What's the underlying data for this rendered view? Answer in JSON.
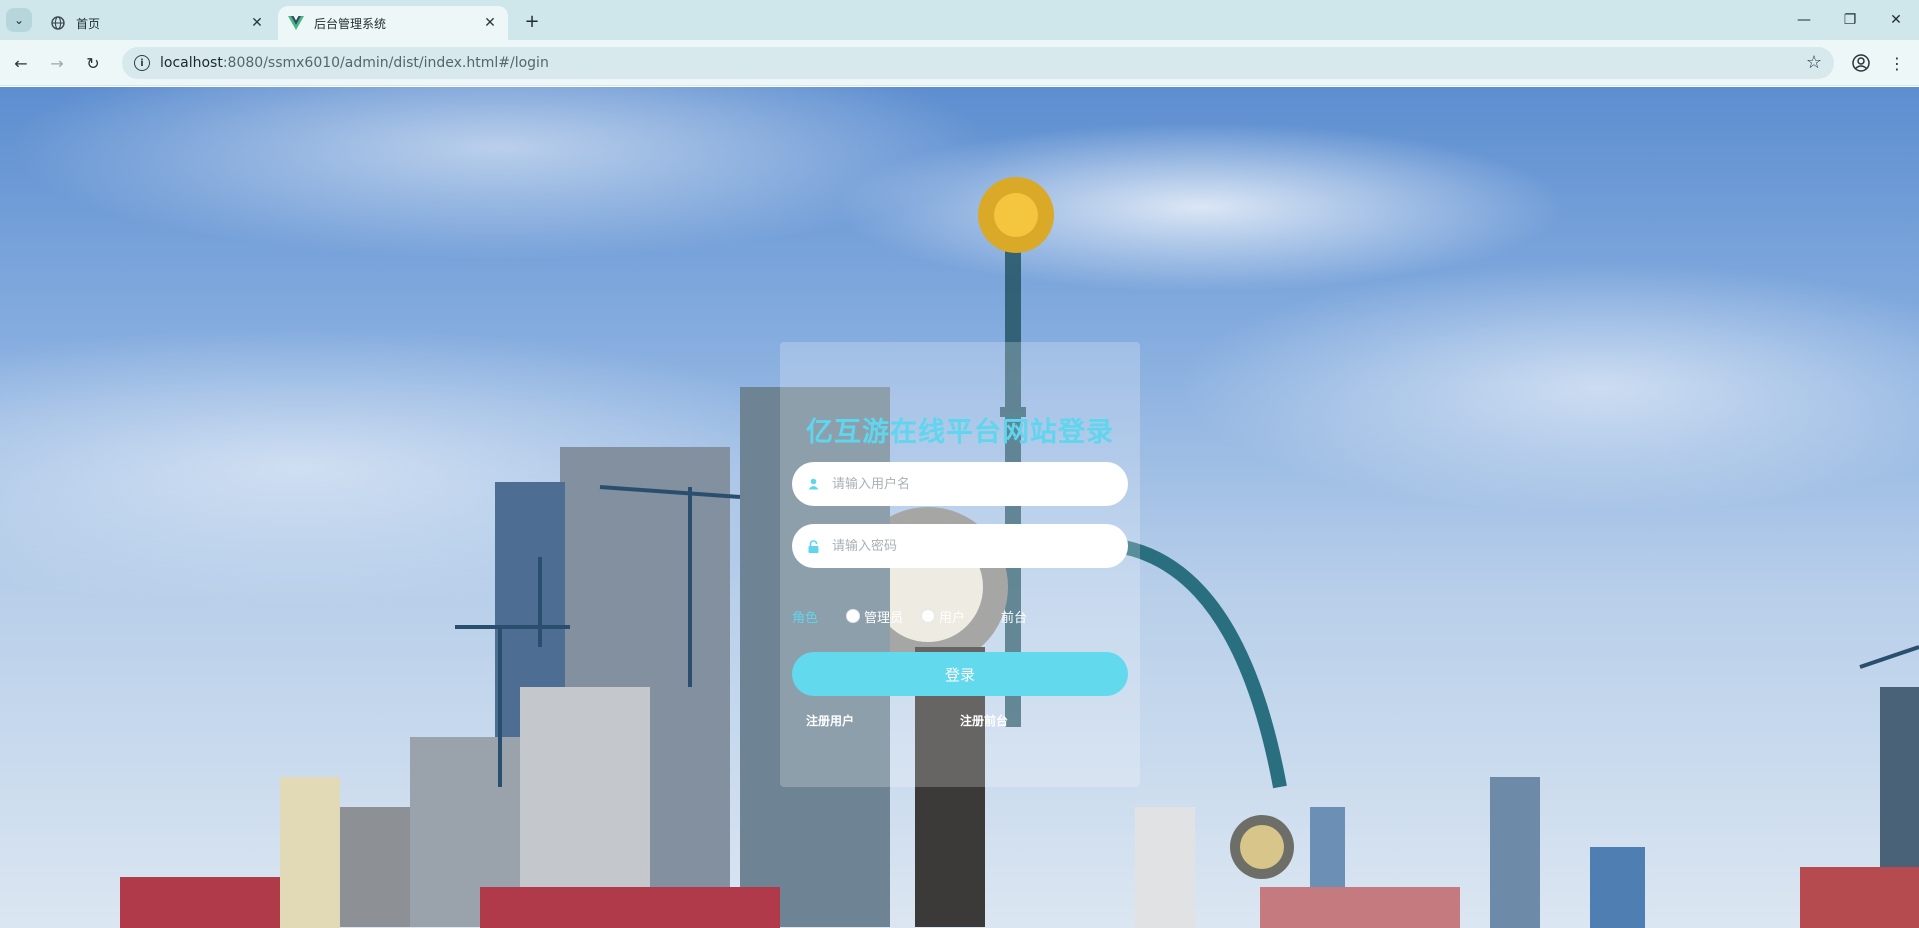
{
  "browser": {
    "tabs": [
      {
        "title": "首页",
        "active": false
      },
      {
        "title": "后台管理系统",
        "active": true
      }
    ],
    "url_host": "localhost",
    "url_rest": ":8080/ssmx6010/admin/dist/index.html#/login"
  },
  "login": {
    "title": "亿互游在线平台网站登录",
    "username_placeholder": "请输入用户名",
    "password_placeholder": "请输入密码",
    "role_label": "角色",
    "roles": [
      "管理员",
      "用户",
      "前台"
    ],
    "login_button": "登录",
    "register_user": "注册用户",
    "register_front": "注册前台"
  },
  "colors": {
    "accent": "#62d9ec",
    "title": "#5fd5ee"
  }
}
